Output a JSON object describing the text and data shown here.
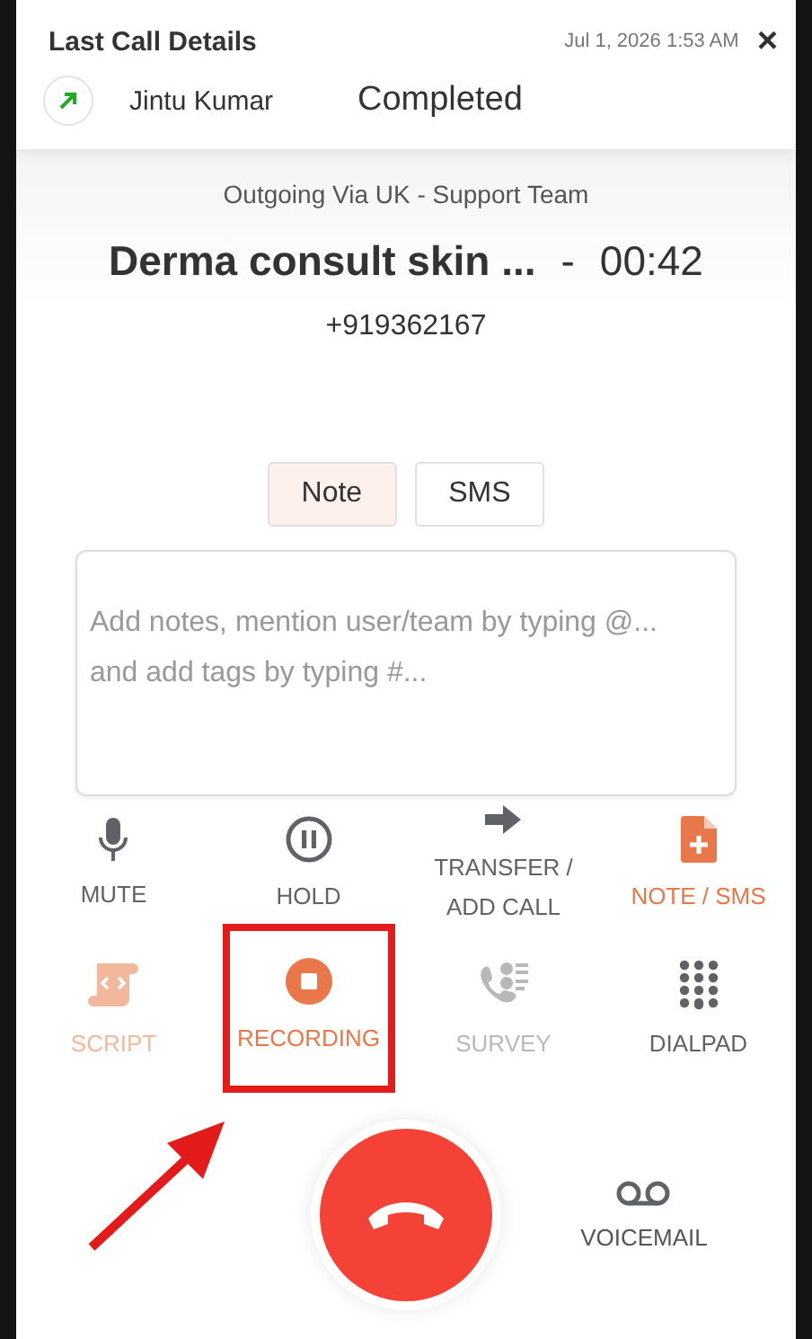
{
  "header": {
    "title": "Last Call Details",
    "timestamp": "Jul 1, 2026 1:53 AM",
    "close": "×",
    "outgoing": true,
    "contact": "Jintu Kumar",
    "status": "Completed"
  },
  "call": {
    "route": "Outgoing Via UK - Support Team",
    "name": "Derma consult skin ...",
    "separator": "-",
    "duration": "00:42",
    "number": "+919362167"
  },
  "tabs": [
    {
      "label": "Note",
      "selected": true
    },
    {
      "label": "SMS",
      "selected": false
    }
  ],
  "note_field": {
    "placeholder": "Add notes, mention user/team by typing @...\nand add tags by typing #..."
  },
  "actions": [
    {
      "kind": "mute",
      "label": "MUTE",
      "active": false,
      "disabled": false,
      "highlighted": false
    },
    {
      "kind": "hold",
      "label": "HOLD",
      "active": false,
      "disabled": false,
      "highlighted": false
    },
    {
      "kind": "transfer",
      "label": "TRANSFER / ADD CALL",
      "active": false,
      "disabled": false,
      "highlighted": false
    },
    {
      "kind": "note",
      "label": "NOTE / SMS",
      "active": true,
      "disabled": false,
      "highlighted": false
    },
    {
      "kind": "script",
      "label": "SCRIPT",
      "active": true,
      "disabled": true,
      "highlighted": false
    },
    {
      "kind": "recording",
      "label": "RECORDING",
      "active": true,
      "disabled": false,
      "highlighted": true
    },
    {
      "kind": "survey",
      "label": "SURVEY",
      "active": false,
      "disabled": true,
      "highlighted": false
    },
    {
      "kind": "dialpad",
      "label": "DIALPAD",
      "active": false,
      "disabled": false,
      "highlighted": false
    }
  ],
  "voicemail": {
    "label": "VOICEMAIL"
  }
}
